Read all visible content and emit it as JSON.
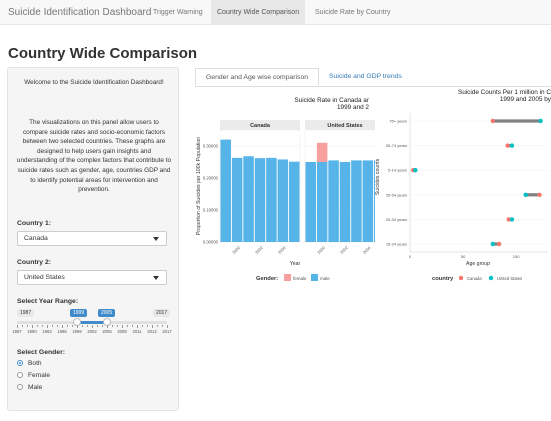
{
  "navbar": {
    "brand": "Suicide Identification Dashboard",
    "tabs": [
      {
        "label": "Trigger Warning"
      },
      {
        "label": "Country Wide Comparison"
      },
      {
        "label": "Suicide Rate by Country"
      }
    ]
  },
  "page_title": "Country Wide Comparison",
  "sidebar": {
    "intro_heading": "Welcome to the Suicide Identification Dashboard!",
    "intro_body": "The visualizations on this panel allow users to compare suicide rates and socio-economic factors between two selected countries. These graphs are designed to help users gain insights and understanding of the complex factors that contribute to suicide rates such as gender, age, countries GDP and to identify potential areas for intervention and prevention.",
    "country1": {
      "label": "Country 1:",
      "value": "Canada"
    },
    "country2": {
      "label": "Country 2:",
      "value": "United States"
    },
    "year_range": {
      "label": "Select Year Range:",
      "min": "1987",
      "max": "2017",
      "from": "1999",
      "to": "2005",
      "ticks": [
        "1987",
        "1990",
        "1993",
        "1996",
        "1999",
        "2002",
        "2005",
        "2008",
        "2011",
        "2014",
        "2017"
      ]
    },
    "gender": {
      "label": "Select Gender:",
      "options": [
        "Both",
        "Female",
        "Male"
      ],
      "selected": "Both"
    }
  },
  "subtabs": [
    {
      "label": "Gender and Age wise comparison"
    },
    {
      "label": "Suicide and GDP trends"
    }
  ],
  "colors": {
    "bar": "#56b4e9",
    "female": "#f8a0a0",
    "male": "#56b4e9",
    "canada": "#f8766d",
    "us": "#00bfc4",
    "link": "#337ab7",
    "slider": "#428bca"
  },
  "chart_data": [
    {
      "type": "bar",
      "title": "Suicide Rate in Canada ar",
      "title_line2": "1999 and 2",
      "xlabel": "Year",
      "ylabel": "Proportion of Suicides per 100k Population",
      "panels": [
        {
          "name": "Canada",
          "years": [
            1999,
            2000,
            2001,
            2002,
            2003,
            2004,
            2005
          ],
          "male": [
            0.32,
            0.263,
            0.268,
            0.262,
            0.263,
            0.258,
            0.251
          ],
          "female": [
            0,
            0,
            0,
            0,
            0,
            0,
            0
          ]
        },
        {
          "name": "United States",
          "years": [
            1999,
            2000,
            2001,
            2002,
            2003,
            2004,
            2005
          ],
          "male": [
            0.25,
            0.25,
            0.255,
            0.25,
            0.255,
            0.255,
            0.255
          ],
          "female": [
            0,
            0.06,
            0,
            0,
            0,
            0,
            0
          ]
        }
      ],
      "ylim": [
        0,
        0.35
      ],
      "yticks": [
        "0.00000",
        "0.10000",
        "0.20000",
        "0.30000"
      ],
      "xticks": [
        "2000",
        "2002",
        "2004"
      ],
      "legend": {
        "title": "Gender:",
        "entries": [
          "female",
          "male"
        ],
        "placement": "bottom"
      }
    },
    {
      "type": "scatter",
      "title": "Suicide Counts Per 1 million in C",
      "title_line2": "1999 and 2005 by",
      "xlabel": "Age group",
      "ylabel": "Suicides counts",
      "categories": [
        "75+ years",
        "55-74 years",
        "5-14 years",
        "35-54 years",
        "25-34 years",
        "15-24 years"
      ],
      "xticks": [
        "0",
        "50",
        "100"
      ],
      "xlim": [
        0,
        130
      ],
      "series": [
        {
          "name": "Canada",
          "values": [
            78,
            92,
            3,
            122,
            93,
            84
          ]
        },
        {
          "name": "United States",
          "values": [
            123,
            96,
            5,
            109,
            96,
            78
          ]
        }
      ],
      "legend": {
        "title": "country",
        "entries": [
          "Canada",
          "United States"
        ],
        "placement": "bottom"
      }
    }
  ]
}
